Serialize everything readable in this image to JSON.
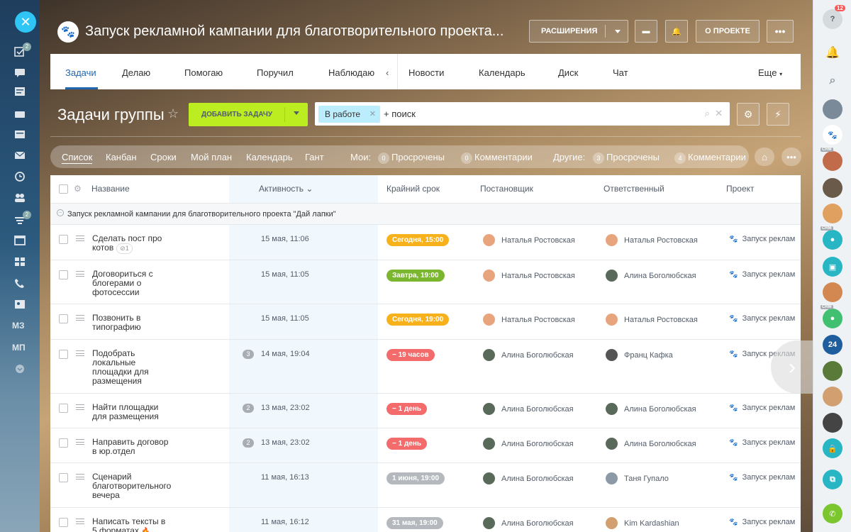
{
  "header": {
    "title": "Запуск рекламной кампании для благотворительного проекта...",
    "extensions_label": "РАСШИРЕНИЯ",
    "about_label": "О ПРОЕКТЕ"
  },
  "tabs": [
    {
      "label": "Задачи",
      "active": true
    },
    {
      "label": "Делаю"
    },
    {
      "label": "Помогаю"
    },
    {
      "label": "Поручил"
    },
    {
      "label": "Наблюдаю"
    },
    {
      "label": "Новости"
    },
    {
      "label": "Календарь"
    },
    {
      "label": "Диск"
    },
    {
      "label": "Чат"
    },
    {
      "label": "Еще"
    }
  ],
  "toolbar": {
    "group_title": "Задачи группы",
    "add_task_label": "ДОБАВИТЬ ЗАДАЧУ",
    "filter_chip": "В работе",
    "search_placeholder": "+ поиск"
  },
  "views": {
    "list": "Список",
    "kanban": "Канбан",
    "deadlines": "Сроки",
    "my_plan": "Мой план",
    "calendar": "Календарь",
    "gantt": "Гант",
    "mine_label": "Мои:",
    "mine_overdue_count": "0",
    "mine_overdue": "Просрочены",
    "mine_comments_count": "0",
    "mine_comments": "Комментарии",
    "others_label": "Другие:",
    "others_overdue_count": "3",
    "others_overdue": "Просрочены",
    "others_comments_count": "4",
    "others_comments": "Комментарии"
  },
  "grid": {
    "columns": {
      "name": "Название",
      "activity": "Активность",
      "deadline": "Крайний срок",
      "creator": "Постановщик",
      "responsible": "Ответственный",
      "project": "Проект"
    },
    "group_label": "Запуск рекламной кампании для благотворительного проекта \"Дай лапки\"",
    "rows": [
      {
        "name": "Сделать пост про котов",
        "attach": "1",
        "activity": "15 мая, 11:06",
        "deadline": "Сегодня, 15:00",
        "deadline_color": "#f7b21b",
        "creator": "Наталья Ростовская",
        "responsible": "Наталья Ростовская",
        "project": "Запуск реклам"
      },
      {
        "name": "Договориться с блогерами о фотосессии",
        "activity": "15 мая, 11:05",
        "deadline": "Завтра, 19:00",
        "deadline_color": "#7bb62f",
        "creator": "Наталья Ростовская",
        "responsible": "Алина Боголюбская",
        "project": "Запуск реклам"
      },
      {
        "name": "Позвонить в типографию",
        "activity": "15 мая, 11:05",
        "deadline": "Сегодня, 19:00",
        "deadline_color": "#f7b21b",
        "creator": "Наталья Ростовская",
        "responsible": "Наталья Ростовская",
        "project": "Запуск реклам"
      },
      {
        "name": "Подобрать локальные площадки для размещения",
        "count": "3",
        "activity": "14 мая, 19:04",
        "deadline": "− 19 часов",
        "deadline_color": "#f36b6b",
        "creator": "Алина Боголюбская",
        "responsible": "Франц Кафка",
        "project": "Запуск реклам"
      },
      {
        "name": "Найти площадки для размещения",
        "count": "2",
        "activity": "13 мая, 23:02",
        "deadline": "− 1 день",
        "deadline_color": "#f36b6b",
        "creator": "Алина Боголюбская",
        "responsible": "Алина Боголюбская",
        "project": "Запуск реклам"
      },
      {
        "name": "Направить договор в юр.отдел",
        "count": "2",
        "activity": "13 мая, 23:02",
        "deadline": "− 1 день",
        "deadline_color": "#f36b6b",
        "creator": "Алина Боголюбская",
        "responsible": "Алина Боголюбская",
        "project": "Запуск реклам"
      },
      {
        "name": "Сценарий благотворительного вечера",
        "activity": "11 мая, 16:13",
        "deadline": "1 июня, 19:00",
        "deadline_color": "#b5b9be",
        "creator": "Алина Боголюбская",
        "responsible": "Таня Гупало",
        "project": "Запуск реклам"
      },
      {
        "name": "Написать тексты в 5 форматах",
        "activity": "11 мая, 16:12",
        "deadline": "31 мая, 19:00",
        "deadline_color": "#b5b9be",
        "creator": "Алина Боголюбская",
        "responsible": "Kim Kardashian",
        "project": "Запуск реклам"
      }
    ]
  },
  "leftbar": {
    "badge_1": "2",
    "badge_2": "2",
    "mz": "МЗ",
    "mp": "МП"
  },
  "rightbar": {
    "help_badge": "12",
    "crm": "CRM",
    "b24": "24"
  },
  "colors": {
    "accent": "#2067b0",
    "add_button": "#bbed21",
    "filter_chip": "#bcedfc"
  }
}
